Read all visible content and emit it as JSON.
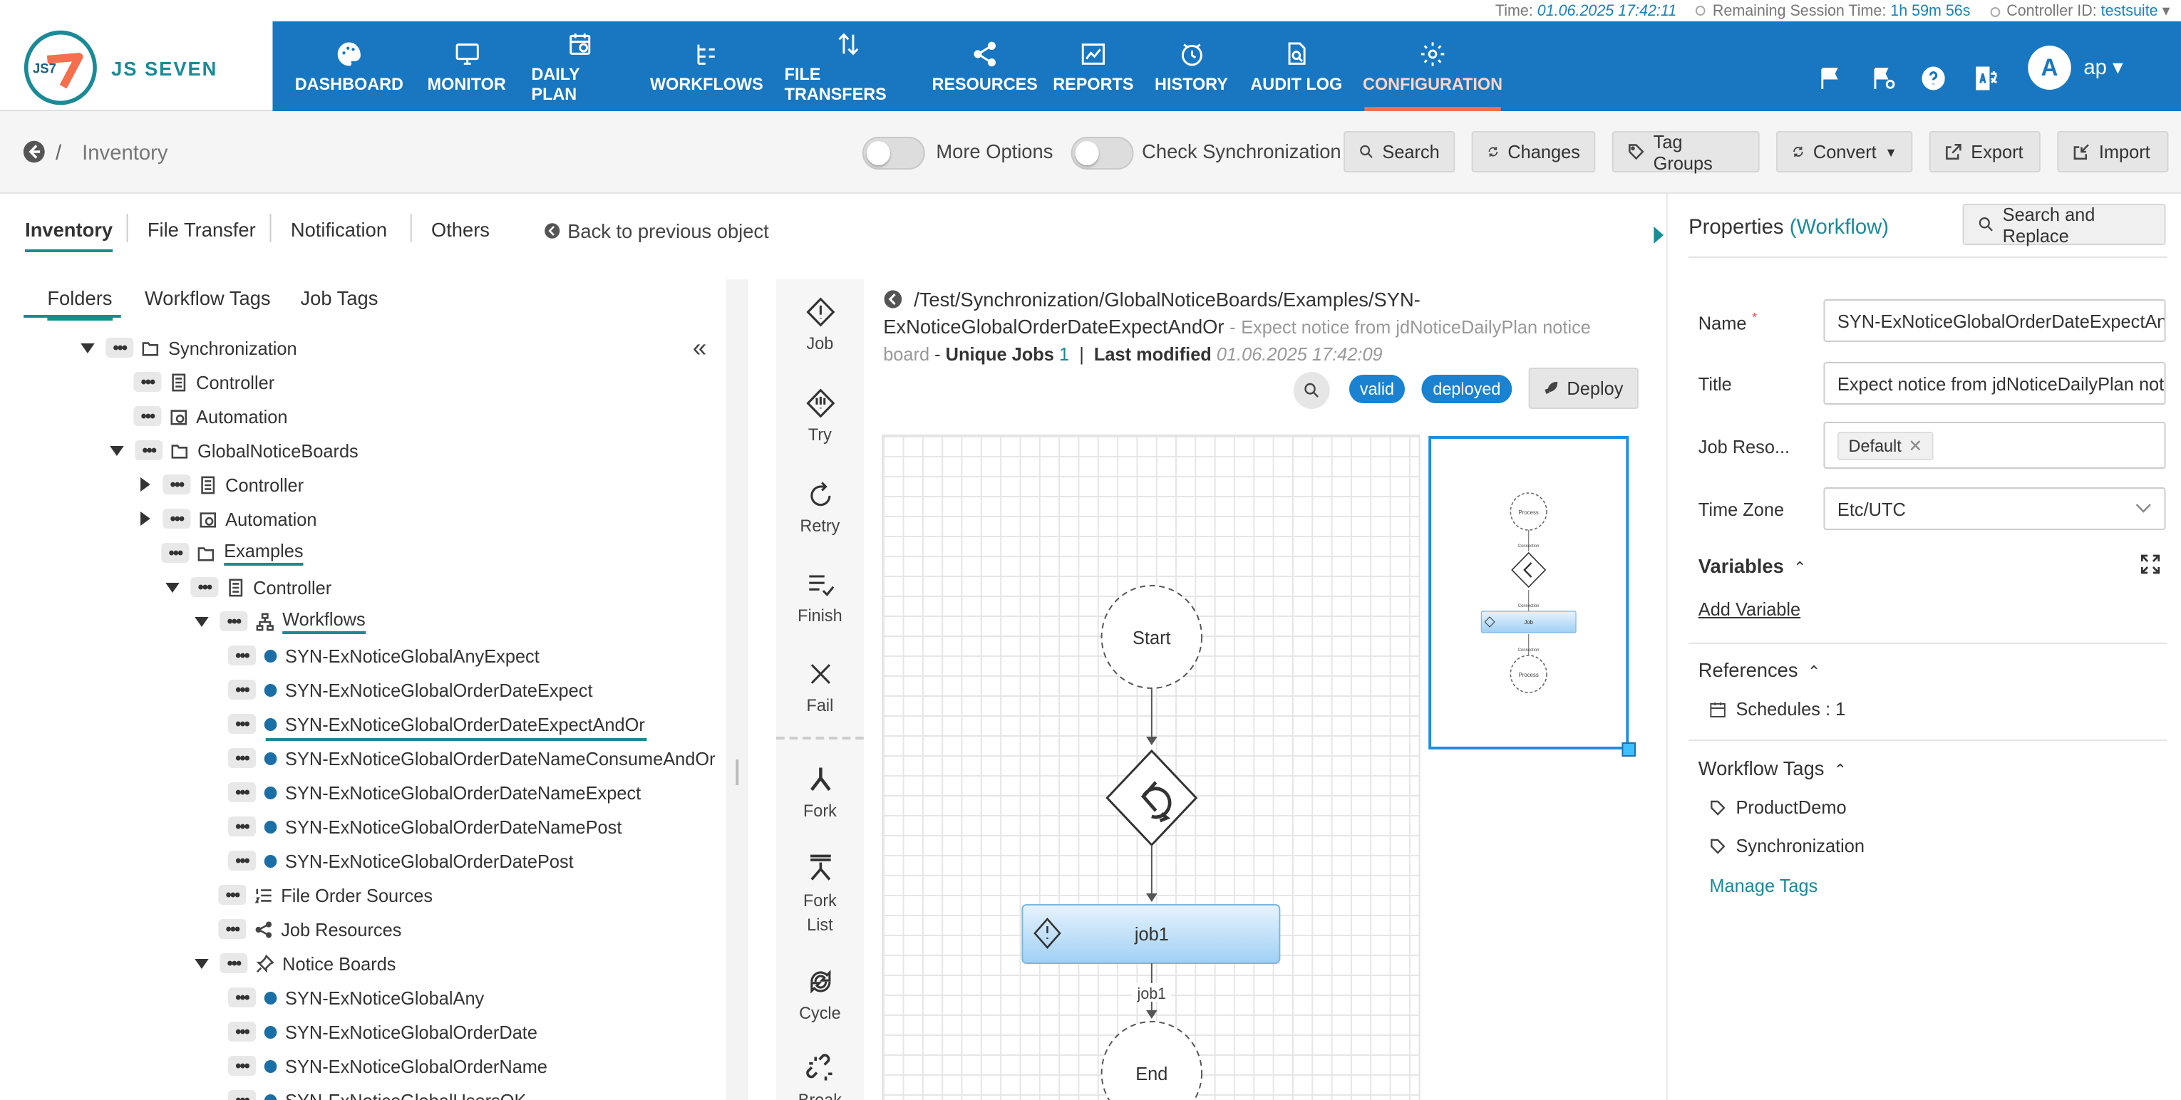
{
  "status": {
    "time_label": "Time:",
    "time_value": "01.06.2025 17:42:11",
    "session_label": "Remaining Session Time:",
    "session_value": "1h 59m 56s",
    "controller_label": "Controller ID:",
    "controller_value": "testsuite"
  },
  "logo": {
    "text": "JS SEVEN",
    "mark": "JS7"
  },
  "nav": [
    {
      "label": "DASHBOARD",
      "icon": "palette-icon"
    },
    {
      "label": "MONITOR",
      "icon": "monitor-icon"
    },
    {
      "label": "DAILY PLAN",
      "icon": "calendar-icon"
    },
    {
      "label": "WORKFLOWS",
      "icon": "workflow-icon"
    },
    {
      "label": "FILE TRANSFERS",
      "icon": "transfer-icon"
    },
    {
      "label": "RESOURCES",
      "icon": "share-icon"
    },
    {
      "label": "REPORTS",
      "icon": "chart-icon"
    },
    {
      "label": "HISTORY",
      "icon": "clock-icon"
    },
    {
      "label": "AUDIT LOG",
      "icon": "audit-icon"
    },
    {
      "label": "CONFIGURATION",
      "icon": "gear-icon"
    }
  ],
  "user": {
    "avatar": "A",
    "name": "ap"
  },
  "breadcrumb": {
    "sep": "/",
    "title": "Inventory"
  },
  "toolbar": {
    "more_options": "More Options",
    "check_sync": "Check Synchronization",
    "search": "Search",
    "changes": "Changes",
    "tag_groups": "Tag Groups",
    "convert": "Convert",
    "export": "Export",
    "import": "Import"
  },
  "tabs": [
    "Inventory",
    "File Transfer",
    "Notification",
    "Others"
  ],
  "back_label": "Back to previous object",
  "subtabs": [
    "Folders",
    "Workflow Tags",
    "Job Tags"
  ],
  "tree": [
    {
      "label": "Synchronization"
    },
    {
      "label": "Controller"
    },
    {
      "label": "Automation"
    },
    {
      "label": "GlobalNoticeBoards"
    },
    {
      "label": "Controller"
    },
    {
      "label": "Automation"
    },
    {
      "label": "Examples"
    },
    {
      "label": "Controller"
    },
    {
      "label": "Workflows"
    },
    {
      "label": "SYN-ExNoticeGlobalAnyExpect"
    },
    {
      "label": "SYN-ExNoticeGlobalOrderDateExpect"
    },
    {
      "label": "SYN-ExNoticeGlobalOrderDateExpectAndOr"
    },
    {
      "label": "SYN-ExNoticeGlobalOrderDateNameConsumeAndOr"
    },
    {
      "label": "SYN-ExNoticeGlobalOrderDateNameExpect"
    },
    {
      "label": "SYN-ExNoticeGlobalOrderDateNamePost"
    },
    {
      "label": "SYN-ExNoticeGlobalOrderDatePost"
    },
    {
      "label": "File Order Sources"
    },
    {
      "label": "Job Resources"
    },
    {
      "label": "Notice Boards"
    },
    {
      "label": "SYN-ExNoticeGlobalAny"
    },
    {
      "label": "SYN-ExNoticeGlobalOrderDate"
    },
    {
      "label": "SYN-ExNoticeGlobalOrderName"
    },
    {
      "label": "SYN-ExNoticeGlobalUsersOK"
    }
  ],
  "palette": [
    "Job",
    "Try",
    "Retry",
    "Finish",
    "Fail",
    "Fork",
    "Fork List",
    "Cycle",
    "Break"
  ],
  "workflow": {
    "path": "/Test/Synchronization/GlobalNoticeBoards/Examples/SYN-",
    "path2": "ExNoticeGlobalOrderDateExpectAndOr",
    "title_sep": "-",
    "description": "Expect notice from jdNoticeDailyPlan notice",
    "description2": "board",
    "unique_label": "Unique Jobs",
    "unique_value": "1",
    "modified_label": "Last modified",
    "modified_value": "01.06.2025 17:42:09",
    "valid": "valid",
    "deployed": "deployed",
    "deploy": "Deploy"
  },
  "graph": {
    "start": "Start",
    "end": "End",
    "job": "job1",
    "edge_label": "job1",
    "mini_process": "Process",
    "mini_connection": "Connection",
    "mini_job": "Job"
  },
  "props": {
    "title": "Properties",
    "type": "(Workflow)",
    "search_replace": "Search and Replace",
    "name_label": "Name",
    "required": "*",
    "name_value": "SYN-ExNoticeGlobalOrderDateExpectAndOr",
    "title_label": "Title",
    "title_value": "Expect notice from jdNoticeDailyPlan notice board",
    "jobres_label": "Job Reso...",
    "jobres_chip": "Default",
    "tz_label": "Time Zone",
    "tz_value": "Etc/UTC",
    "variables": "Variables",
    "add_variable": "Add Variable",
    "references": "References",
    "schedules": "Schedules : 1",
    "wf_tags": "Workflow Tags",
    "tags": [
      "ProductDemo",
      "Synchronization"
    ],
    "manage_tags": "Manage Tags"
  }
}
